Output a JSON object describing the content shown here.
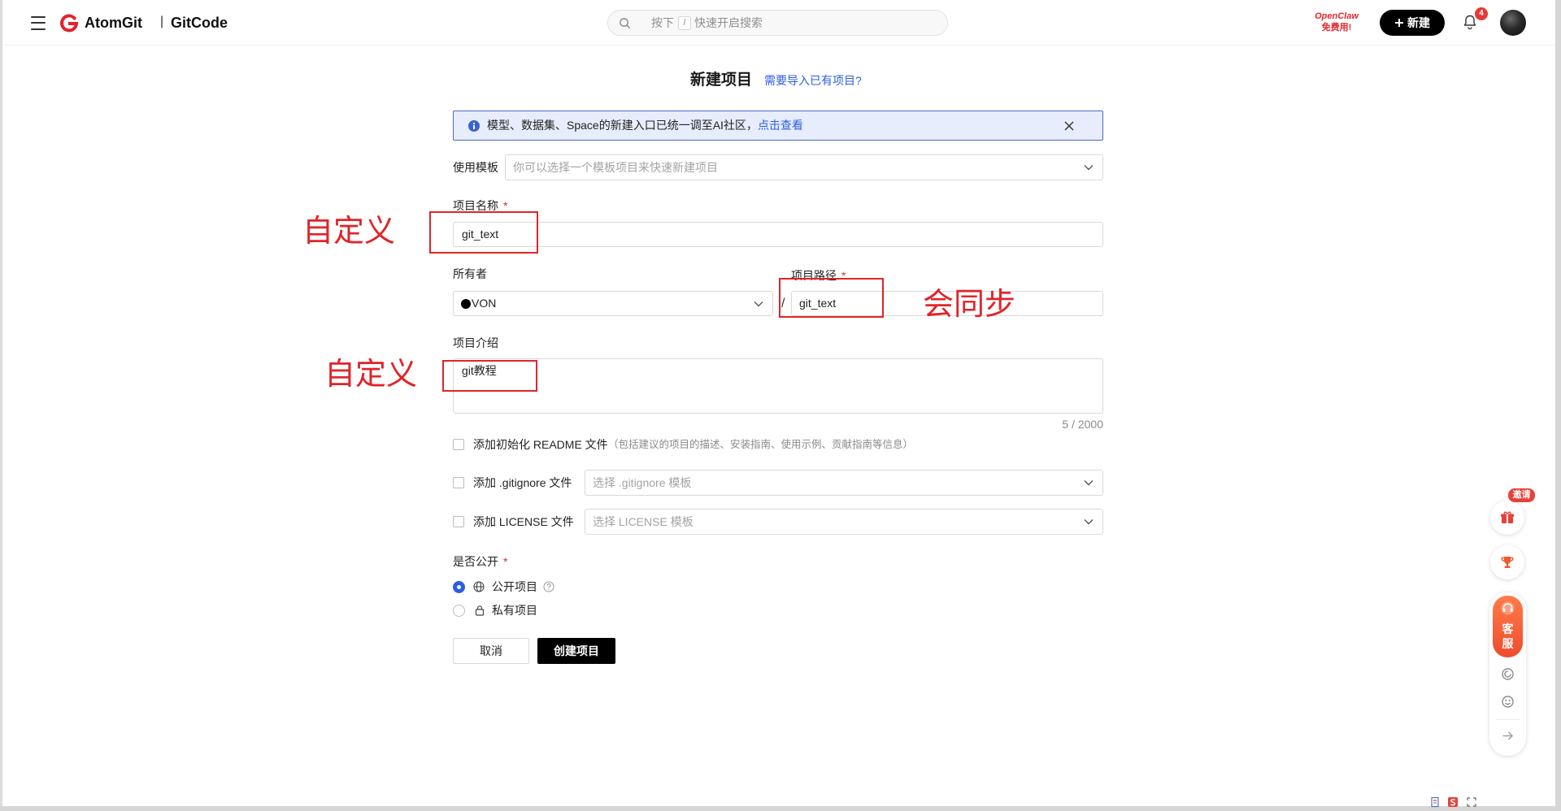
{
  "colors": {
    "accent": "#2b5fe3",
    "danger": "#e0242a",
    "brand": "#e5212a",
    "notice_bg": "#e7edfc",
    "primary_button": "#000000"
  },
  "header": {
    "menu_icon": "hamburger-menu-icon",
    "logo_icon": "atomgit-logo-icon",
    "brand_primary": "AtomGit",
    "brand_divider": "|",
    "brand_secondary": "GitCode",
    "search": {
      "icon": "search-icon",
      "prefix": "按下",
      "key": "/",
      "placeholder": "快速开启搜索"
    },
    "promo": {
      "line1": "OpenClaw",
      "line2": "免费用!"
    },
    "new_button": {
      "icon": "plus-icon",
      "label": "新建"
    },
    "notifications": {
      "icon": "bell-icon",
      "count": "4"
    },
    "avatar_icon": "user-avatar"
  },
  "page": {
    "title": "新建项目",
    "import_link": "需要导入已有项目?"
  },
  "notice": {
    "icon": "info-icon",
    "text": "模型、数据集、Space的新建入口已统一调至AI社区，",
    "link": "点击查看",
    "close_icon": "close-icon"
  },
  "form": {
    "template": {
      "label": "使用模板",
      "placeholder": "你可以选择一个模板项目来快速新建项目"
    },
    "project_name": {
      "label": "项目名称",
      "required_mark": "*",
      "value": "git_text"
    },
    "owner": {
      "label": "所有者",
      "value": "VON"
    },
    "path": {
      "label": "项目路径",
      "required_mark": "*",
      "separator": "/",
      "value": "git_text"
    },
    "description": {
      "label": "项目介绍",
      "value": "git教程",
      "counter": "5 / 2000"
    },
    "readme": {
      "checked": false,
      "label": "添加初始化 README 文件",
      "hint": "（包括建议的项目的描述、安装指南、使用示例、贡献指南等信息）"
    },
    "gitignore": {
      "checked": false,
      "label": "添加 .gitignore 文件",
      "placeholder": "选择 .gitignore 模板"
    },
    "license": {
      "checked": false,
      "label": "添加 LICENSE 文件",
      "placeholder": "选择 LICENSE 模板"
    },
    "visibility": {
      "label": "是否公开",
      "required_mark": "*",
      "options": [
        {
          "label": "公开项目",
          "icon": "globe-icon",
          "selected": true
        },
        {
          "label": "私有项目",
          "icon": "lock-icon",
          "selected": false
        }
      ]
    },
    "buttons": {
      "cancel": "取消",
      "create": "创建项目"
    }
  },
  "annotations": {
    "name_note": "自定义",
    "path_note": "会同步",
    "description_note": "自定义"
  },
  "float_sidebar": {
    "invite_badge": "邀请",
    "service_chars": [
      "客",
      "服"
    ]
  }
}
